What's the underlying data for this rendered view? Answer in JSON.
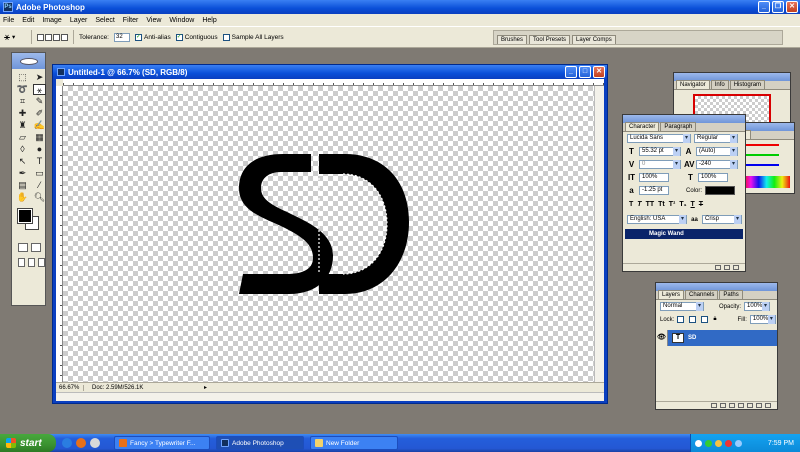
{
  "app": {
    "title": "Adobe Photoshop"
  },
  "menu": [
    "File",
    "Edit",
    "Image",
    "Layer",
    "Select",
    "Filter",
    "View",
    "Window",
    "Help"
  ],
  "options": {
    "tolerance_label": "Tolerance:",
    "tolerance_value": "32",
    "antialias": "Anti-alias",
    "contiguous": "Contiguous",
    "sample_all": "Sample All Layers",
    "well_tabs": [
      "Brushes",
      "Tool Presets",
      "Layer Comps"
    ]
  },
  "document": {
    "title": "Untitled-1 @ 66.7% (SD, RGB/8)",
    "artwork_text": "SD",
    "zoom": "66.67%",
    "doc_size": "Doc: 2.59M/526.1K"
  },
  "navigator": {
    "tabs": [
      "Navigator",
      "Info",
      "Histogram"
    ]
  },
  "character": {
    "tabs": [
      "Character",
      "Paragraph"
    ],
    "font": "Lucida Sans",
    "style": "Regular",
    "size": "55.32 pt",
    "leading": "(Auto)",
    "kerning": "0",
    "tracking": "-240",
    "vscale": "100%",
    "hscale": "100%",
    "baseline": "-1.25 pt",
    "color_label": "Color:",
    "language": "English: USA",
    "antialias": "Crisp",
    "history_item": "Magic Wand"
  },
  "layers": {
    "tabs": [
      "Layers",
      "Channels",
      "Paths"
    ],
    "blend_mode": "Normal",
    "opacity_label": "Opacity:",
    "opacity": "100%",
    "lock_label": "Lock:",
    "fill_label": "Fill:",
    "fill": "100%",
    "layer_name": "SD"
  },
  "taskbar": {
    "start": "start",
    "tasks": [
      "Fancy > Typewriter F...",
      "Adobe Photoshop",
      "New Folder"
    ],
    "clock": "7:59 PM"
  },
  "colors": {
    "xp_blue": "#0a4fd8",
    "selection_blue": "#316ac5",
    "foreground": "#000000",
    "background": "#ffffff"
  }
}
